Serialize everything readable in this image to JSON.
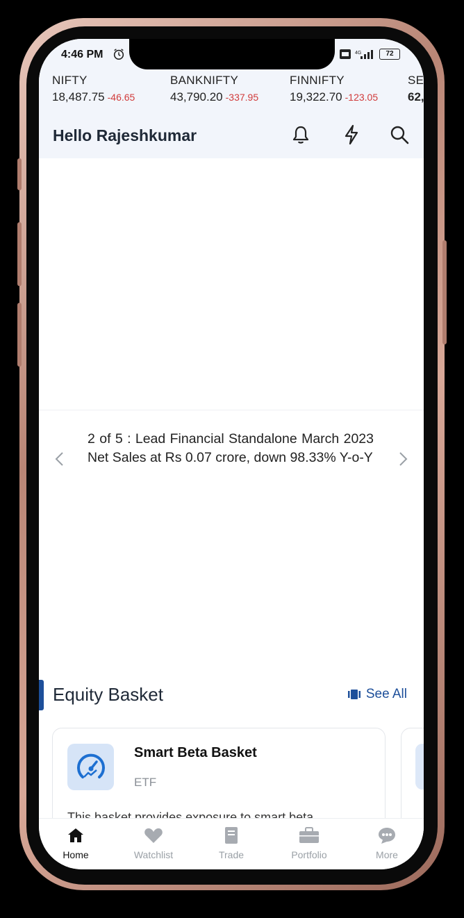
{
  "status": {
    "time": "4:46 PM",
    "battery": "72"
  },
  "ticker": [
    {
      "name": "NIFTY",
      "value": "18,487.75",
      "change": "-46.65"
    },
    {
      "name": "BANKNIFTY",
      "value": "43,790.20",
      "change": "-337.95"
    },
    {
      "name": "FINNIFTY",
      "value": "19,322.70",
      "change": "-123.05"
    },
    {
      "name": "SE",
      "value": "62,",
      "change": ""
    }
  ],
  "header": {
    "greeting": "Hello Rajeshkumar"
  },
  "news": {
    "text": "2 of 5 : Lead Financial Standalone March 2023 Net Sales at Rs 0.07 crore, down 98.33% Y-o-Y"
  },
  "equity_basket": {
    "title": "Equity Basket",
    "see_all": "See All",
    "card": {
      "title": "Smart Beta Basket",
      "subtitle": "ETF",
      "description": "This basket provides exposure to smart beta"
    }
  },
  "nav": [
    {
      "label": "Home",
      "icon": "home-icon",
      "active": true
    },
    {
      "label": "Watchlist",
      "icon": "heart-icon",
      "active": false
    },
    {
      "label": "Trade",
      "icon": "book-icon",
      "active": false
    },
    {
      "label": "Portfolio",
      "icon": "briefcase-icon",
      "active": false
    },
    {
      "label": "More",
      "icon": "more-icon",
      "active": false
    }
  ],
  "colors": {
    "accent": "#1d4f9a",
    "negative": "#d13b3b",
    "header_bg": "#f2f5fb"
  }
}
